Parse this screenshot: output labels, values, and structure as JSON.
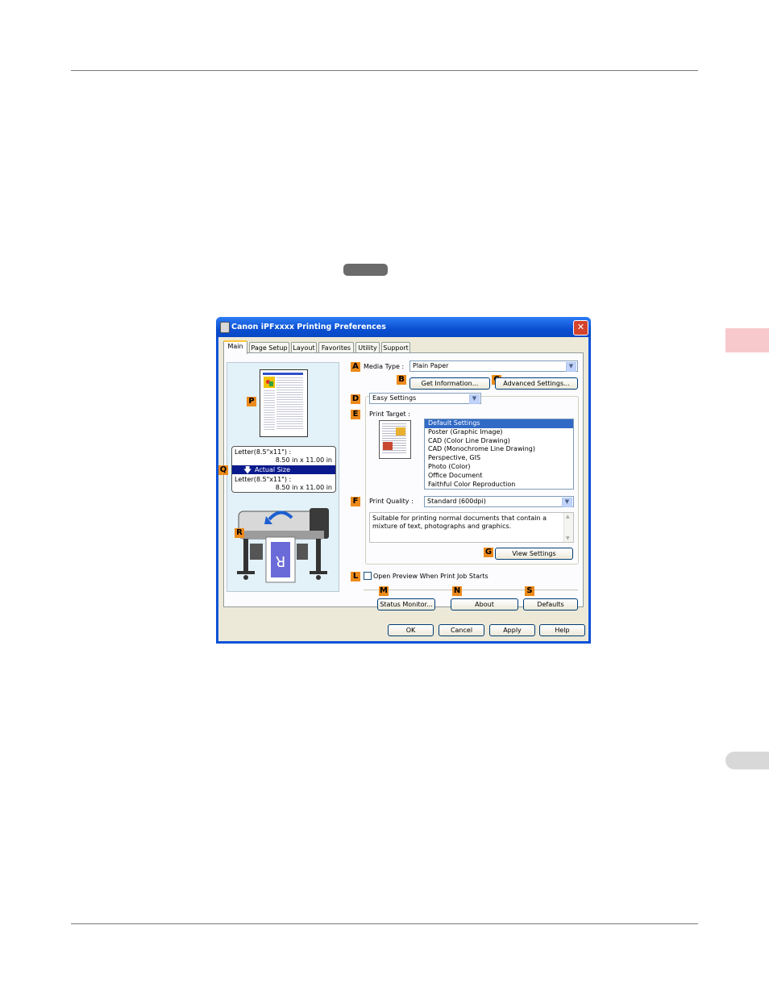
{
  "window": {
    "title": "Canon iPFxxxx Printing Preferences",
    "close_glyph": "✕"
  },
  "tabs": [
    {
      "label": "Main"
    },
    {
      "label": "Page Setup"
    },
    {
      "label": "Layout"
    },
    {
      "label": "Favorites"
    },
    {
      "label": "Utility"
    },
    {
      "label": "Support"
    }
  ],
  "markers": {
    "A": "A",
    "B": "B",
    "C": "C",
    "D": "D",
    "E": "E",
    "F": "F",
    "G": "G",
    "L": "L",
    "M": "M",
    "N": "N",
    "S": "S",
    "P": "P",
    "Q": "Q",
    "R": "R"
  },
  "media": {
    "label": "Media Type :",
    "value": "Plain Paper",
    "get_info_button": "Get Information...",
    "advanced_button": "Advanced Settings..."
  },
  "settings_mode": {
    "value": "Easy Settings"
  },
  "print_target": {
    "label": "Print Target :",
    "items": [
      {
        "label": "Default Settings",
        "selected": true
      },
      {
        "label": "Poster (Graphic Image)"
      },
      {
        "label": "CAD (Color Line Drawing)"
      },
      {
        "label": "CAD (Monochrome Line Drawing)"
      },
      {
        "label": "Perspective, GIS"
      },
      {
        "label": "Photo (Color)"
      },
      {
        "label": "Office Document"
      },
      {
        "label": "Faithful Color Reproduction"
      }
    ]
  },
  "print_quality": {
    "label": "Print Quality :",
    "value": "Standard (600dpi)",
    "description": "Suitable for printing normal documents that contain a mixture of text, photographs and graphics."
  },
  "view_settings_button": "View Settings",
  "open_preview": {
    "label": "Open Preview When Print Job Starts",
    "checked": false
  },
  "bottom_buttons": {
    "status_monitor": "Status Monitor...",
    "about": "About",
    "defaults": "Defaults"
  },
  "dialog_buttons": {
    "ok": "OK",
    "cancel": "Cancel",
    "apply": "Apply",
    "help": "Help"
  },
  "size_info": {
    "input_label": "Letter(8.5\"x11\") :",
    "input_dims": "8.50 in x 11.00 in",
    "scaling": "Actual Size",
    "output_label": "Letter(8.5\"x11\") :",
    "output_dims": "8.50 in x 11.00 in"
  },
  "colors": {
    "marker": "#ec8a1b",
    "selection": "#316ac5",
    "titlebar": "#0a52d8"
  }
}
